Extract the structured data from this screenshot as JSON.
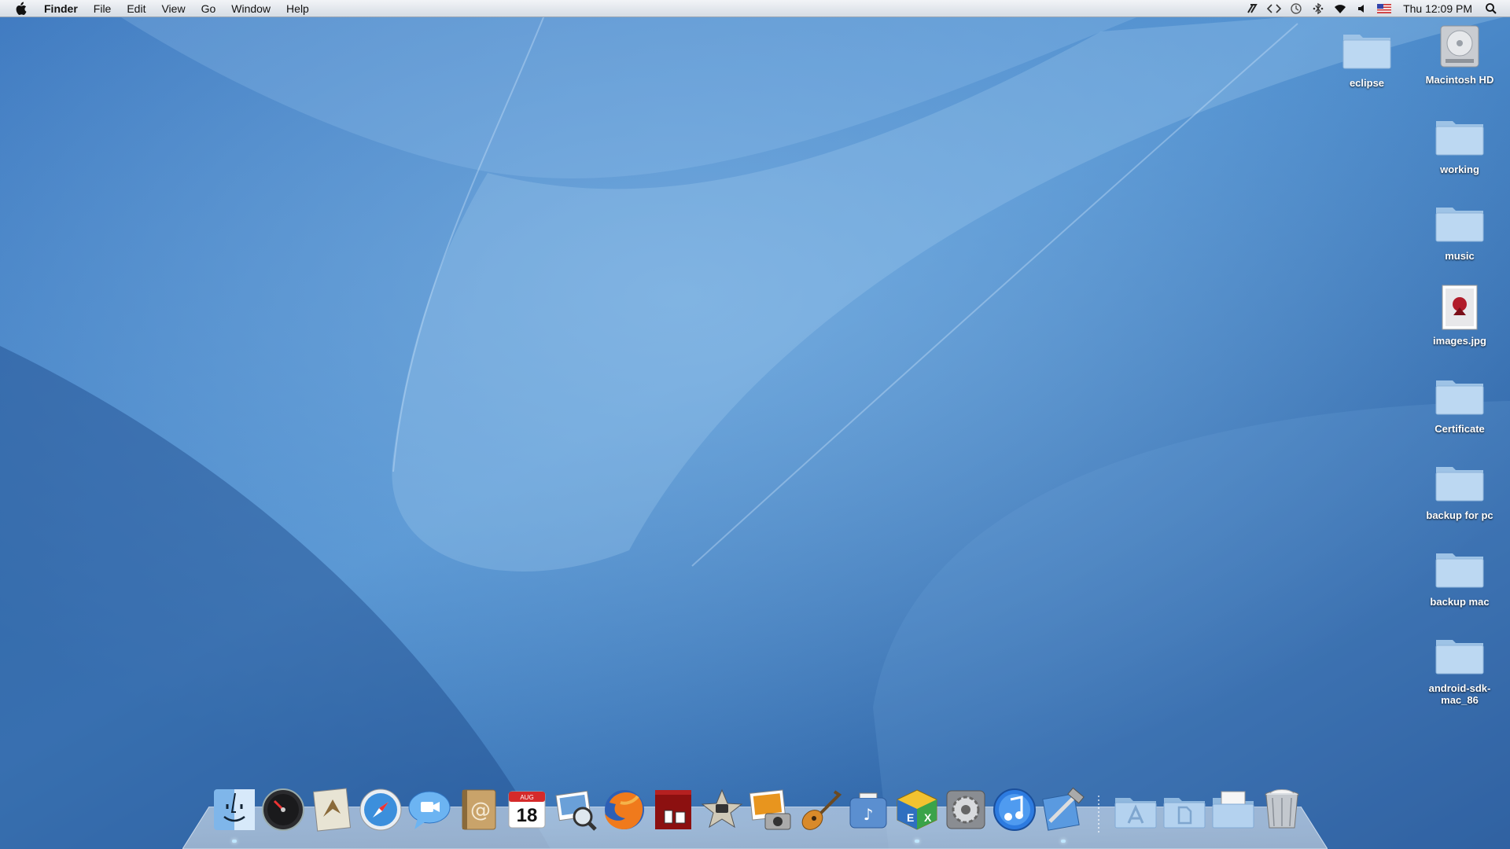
{
  "menubar": {
    "apple_icon": "apple-logo-icon",
    "app_name": "Finder",
    "menus": [
      "File",
      "Edit",
      "View",
      "Go",
      "Window",
      "Help"
    ],
    "status_icons": [
      "script-icon",
      "code-brackets-icon",
      "time-machine-icon",
      "bluetooth-dots-icon",
      "wifi-icon",
      "volume-icon",
      "us-flag-icon"
    ],
    "clock": "Thu 12:09 PM",
    "spotlight_icon": "spotlight-search-icon"
  },
  "desktop": {
    "icons": [
      {
        "label": "eclipse",
        "type": "folder"
      },
      {
        "label": "Macintosh HD",
        "type": "hard-drive"
      },
      {
        "label": "working",
        "type": "folder"
      },
      {
        "label": "music",
        "type": "folder"
      },
      {
        "label": "images.jpg",
        "type": "image-file"
      },
      {
        "label": "Certificate",
        "type": "folder"
      },
      {
        "label": "backup for pc",
        "type": "folder"
      },
      {
        "label": "backup mac",
        "type": "folder"
      },
      {
        "label": "android-sdk-mac_86",
        "type": "folder"
      }
    ]
  },
  "dock": {
    "apps": [
      {
        "icon": "finder-icon",
        "running": true
      },
      {
        "icon": "dashboard-icon",
        "running": false
      },
      {
        "icon": "mail-icon",
        "running": false
      },
      {
        "icon": "safari-icon",
        "running": false
      },
      {
        "icon": "ichat-icon",
        "running": false
      },
      {
        "icon": "address-book-icon",
        "running": false
      },
      {
        "icon": "ical-icon",
        "running": false,
        "calendar_month": "AUG",
        "calendar_day": "18"
      },
      {
        "icon": "preview-icon",
        "running": false
      },
      {
        "icon": "firefox-icon",
        "running": false
      },
      {
        "icon": "front-row-icon",
        "running": false
      },
      {
        "icon": "imovie-icon",
        "running": false
      },
      {
        "icon": "iphoto-icon",
        "running": false
      },
      {
        "icon": "garageband-icon",
        "running": false
      },
      {
        "icon": "itunes-helper-icon",
        "running": false
      },
      {
        "icon": "tex-icon",
        "running": true
      },
      {
        "icon": "system-preferences-icon",
        "running": false
      },
      {
        "icon": "itunes-icon",
        "running": false
      },
      {
        "icon": "xcode-icon",
        "running": true
      }
    ],
    "stacks": [
      {
        "icon": "applications-folder-icon"
      },
      {
        "icon": "documents-folder-icon"
      },
      {
        "icon": "downloads-stack-icon"
      },
      {
        "icon": "trash-icon"
      }
    ]
  }
}
